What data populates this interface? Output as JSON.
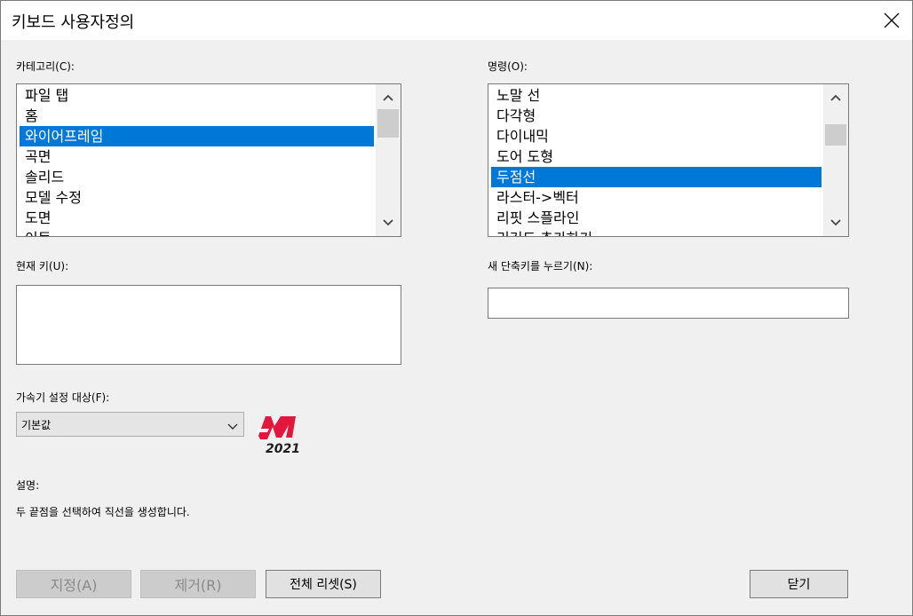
{
  "dialog": {
    "title": "키보드 사용자정의"
  },
  "category": {
    "label": "카테고리(C):",
    "items": [
      "파일 탭",
      "홈",
      "와이어프레임",
      "곡면",
      "솔리드",
      "모델 수정",
      "도면",
      "이동"
    ],
    "selected_index": 2
  },
  "commands": {
    "label": "명령(O):",
    "items": [
      "노말 선",
      "다각형",
      "다이내믹",
      "도어 도형",
      "두점선",
      "라스터->벡터",
      "리핏 스플라인",
      "리커드 추가하기"
    ],
    "selected_index": 4
  },
  "current_key": {
    "label": "현재 키(U):"
  },
  "new_shortcut": {
    "label": "새 단축키를 누르기(N):",
    "value": ""
  },
  "accelerator": {
    "label": "가속기 설정 대상(F):",
    "value": "기본값"
  },
  "logo": {
    "text": "2021"
  },
  "description": {
    "label": "설명:",
    "text": "두 끝점을 선택하여 직선을 생성합니다."
  },
  "buttons": {
    "assign": "지정(A)",
    "remove": "제거(R)",
    "reset_all": "전체 리셋(S)",
    "close": "닫기"
  },
  "colors": {
    "selection": "#0078d7",
    "logo_red": "#e3173e",
    "logo_dark": "#1f1f1f"
  },
  "icons": {
    "close": "close-icon",
    "scroll_up": "chevron-up-icon",
    "scroll_down": "chevron-down-icon",
    "combo": "chevron-down-icon"
  }
}
